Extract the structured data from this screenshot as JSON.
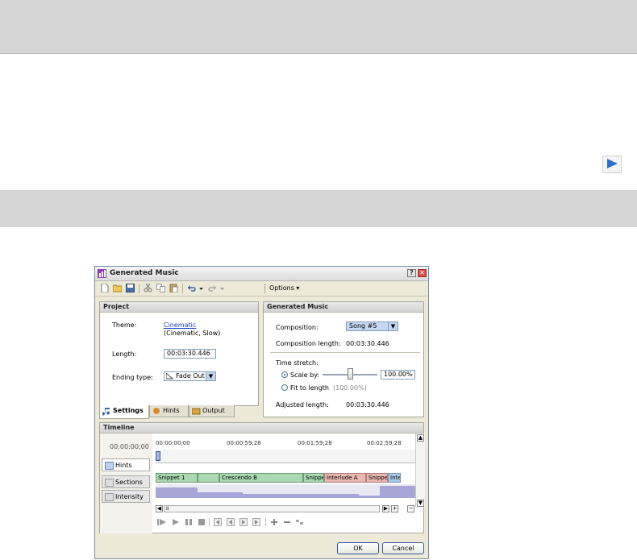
{
  "dialog": {
    "title": "Generated Music",
    "help": "?",
    "close": "✕"
  },
  "toolbar": {
    "options_label": "Options"
  },
  "project": {
    "header": "Project",
    "theme_label": "Theme:",
    "theme_value": "Cinematic",
    "theme_desc": "(Cinematic, Slow)",
    "length_label": "Length:",
    "length_value": "00:03:30.446",
    "ending_label": "Ending type:",
    "ending_value": "Fade Out"
  },
  "tabs": {
    "settings": "Settings",
    "hints": "Hints",
    "output": "Output"
  },
  "generated": {
    "header": "Generated Music",
    "composition_label": "Composition:",
    "composition_value": "Song #5",
    "comp_length_label": "Composition length:",
    "comp_length_value": "00:03:30.446",
    "time_stretch_label": "Time stretch:",
    "scale_label": "Scale by:",
    "scale_value": "100.00%",
    "scale_fraction": 0.5,
    "fit_label": "Fit to length",
    "fit_value": "(100.00%)",
    "adjusted_label": "Adjusted length:",
    "adjusted_value": "00:03:30.446"
  },
  "timeline": {
    "header": "Timeline",
    "timecode": "00:00:00;00",
    "tracks": [
      "Hints",
      "Sections",
      "Intensity"
    ],
    "ticks": [
      "00:00:00;00",
      "00:00:59;28",
      "00:01:59;28",
      "00:02:59;28"
    ],
    "sections": [
      "Snippet 1",
      "Crescendo B",
      "Snippet",
      "Interlude A",
      "Snippet",
      "Inte"
    ],
    "scroll_mark": "II"
  },
  "buttons": {
    "ok": "OK",
    "cancel": "Cancel"
  },
  "colors": {
    "section_green": "#a9d8b1",
    "section_pink": "#e8b7b0",
    "section_blue": "#a9c9ea",
    "intensity": "#a8a6d8"
  }
}
